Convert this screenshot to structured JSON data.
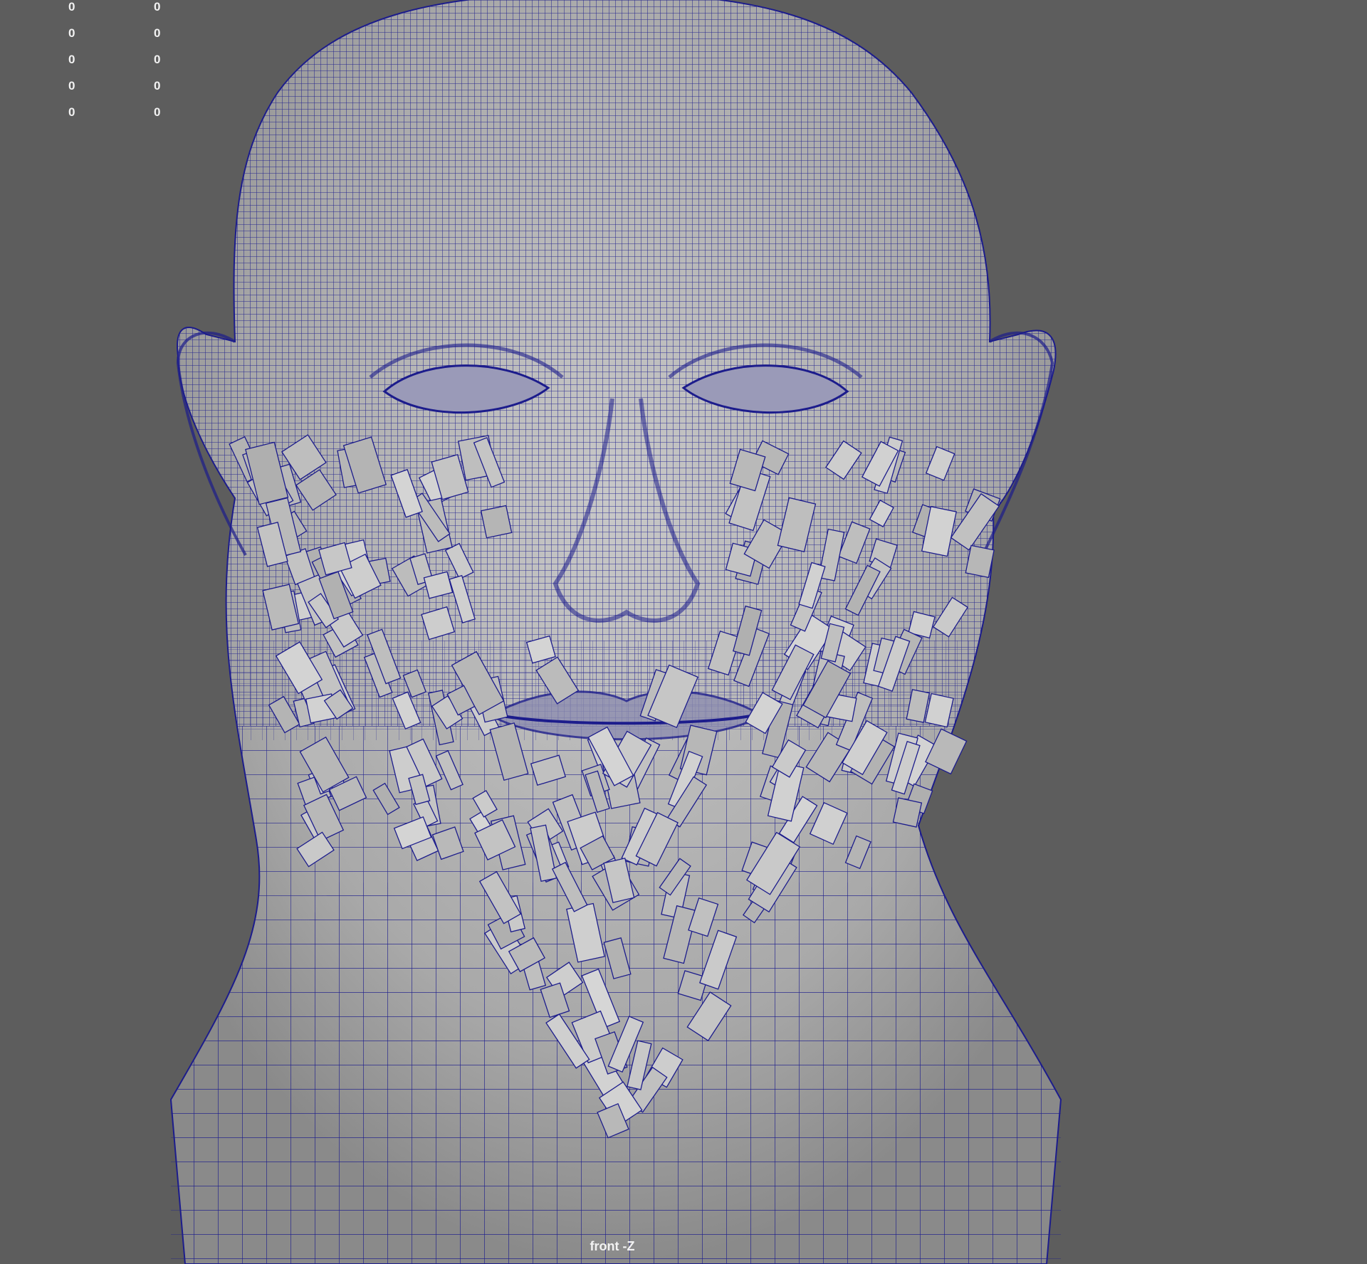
{
  "viewport": {
    "camera_label": "front -Z",
    "background_color": "#5d5d5d",
    "wire_color": "#1c1c8c",
    "mesh_color": "#b4b4b4",
    "hud": {
      "rows": [
        [
          "0",
          "0"
        ],
        [
          "0",
          "0"
        ],
        [
          "0",
          "0"
        ],
        [
          "0",
          "0"
        ],
        [
          "0",
          "0"
        ]
      ]
    }
  }
}
